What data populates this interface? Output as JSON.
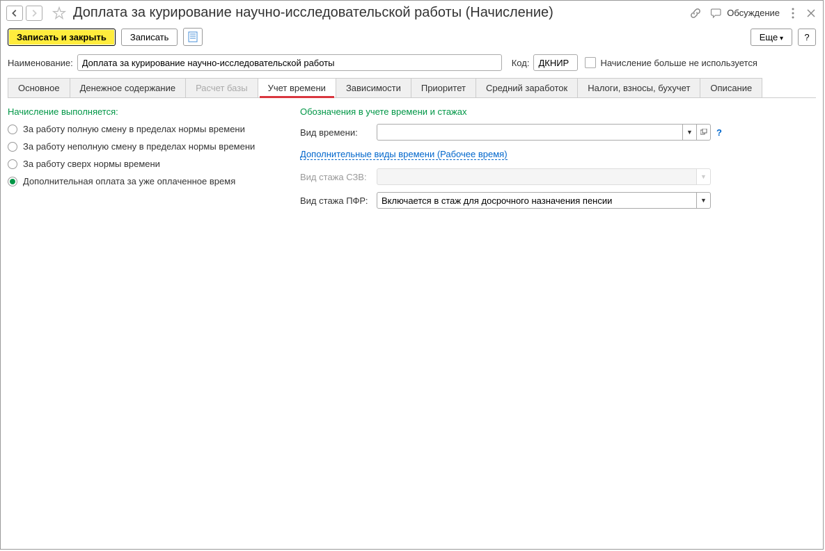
{
  "titlebar": {
    "title": "Доплата за курирование научно-исследовательской работы (Начисление)",
    "discussion": "Обсуждение"
  },
  "toolbar": {
    "save_close": "Записать и закрыть",
    "save": "Записать",
    "more": "Еще",
    "help": "?"
  },
  "fields": {
    "name_label": "Наименование:",
    "name_value": "Доплата за курирование научно-исследовательской работы",
    "code_label": "Код:",
    "code_value": "ДКНИР",
    "not_used": "Начисление больше не используется"
  },
  "tabs": [
    {
      "label": "Основное",
      "state": "normal"
    },
    {
      "label": "Денежное содержание",
      "state": "normal"
    },
    {
      "label": "Расчет базы",
      "state": "disabled"
    },
    {
      "label": "Учет времени",
      "state": "active"
    },
    {
      "label": "Зависимости",
      "state": "normal"
    },
    {
      "label": "Приоритет",
      "state": "normal"
    },
    {
      "label": "Средний заработок",
      "state": "normal"
    },
    {
      "label": "Налоги, взносы, бухучет",
      "state": "normal"
    },
    {
      "label": "Описание",
      "state": "normal"
    }
  ],
  "left": {
    "title": "Начисление выполняется:",
    "radios": [
      {
        "label": "За работу полную смену в пределах нормы времени",
        "checked": false
      },
      {
        "label": "За работу неполную смену в пределах нормы времени",
        "checked": false
      },
      {
        "label": "За работу сверх нормы времени",
        "checked": false
      },
      {
        "label": "Дополнительная оплата за уже оплаченное время",
        "checked": true
      }
    ]
  },
  "right": {
    "title": "Обозначения в учете времени и стажах",
    "time_type_label": "Вид времени:",
    "time_type_value": "",
    "additional_link": "Дополнительные виды времени (Рабочее время)",
    "szv_label": "Вид стажа СЗВ:",
    "szv_value": "",
    "pfr_label": "Вид стажа ПФР:",
    "pfr_value": "Включается в стаж для досрочного назначения пенсии",
    "help": "?"
  }
}
